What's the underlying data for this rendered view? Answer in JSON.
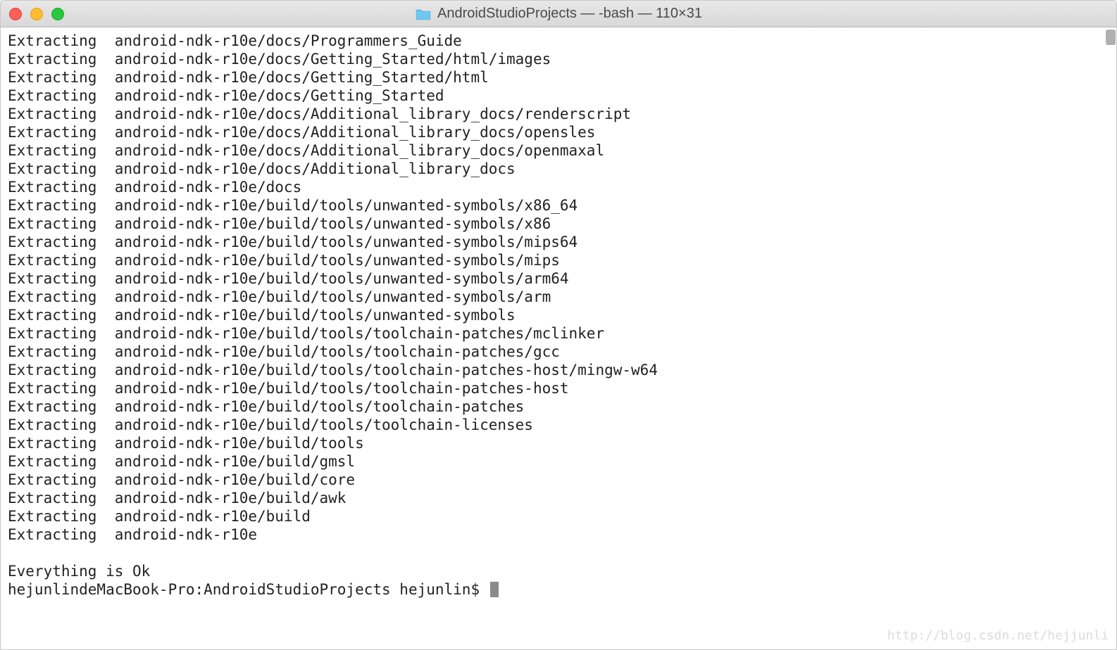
{
  "window": {
    "title": "AndroidStudioProjects — -bash — 110×31"
  },
  "terminal": {
    "lines": [
      {
        "prefix": "Extracting",
        "path": "android-ndk-r10e/docs/Programmers_Guide"
      },
      {
        "prefix": "Extracting",
        "path": "android-ndk-r10e/docs/Getting_Started/html/images"
      },
      {
        "prefix": "Extracting",
        "path": "android-ndk-r10e/docs/Getting_Started/html"
      },
      {
        "prefix": "Extracting",
        "path": "android-ndk-r10e/docs/Getting_Started"
      },
      {
        "prefix": "Extracting",
        "path": "android-ndk-r10e/docs/Additional_library_docs/renderscript"
      },
      {
        "prefix": "Extracting",
        "path": "android-ndk-r10e/docs/Additional_library_docs/opensles"
      },
      {
        "prefix": "Extracting",
        "path": "android-ndk-r10e/docs/Additional_library_docs/openmaxal"
      },
      {
        "prefix": "Extracting",
        "path": "android-ndk-r10e/docs/Additional_library_docs"
      },
      {
        "prefix": "Extracting",
        "path": "android-ndk-r10e/docs"
      },
      {
        "prefix": "Extracting",
        "path": "android-ndk-r10e/build/tools/unwanted-symbols/x86_64"
      },
      {
        "prefix": "Extracting",
        "path": "android-ndk-r10e/build/tools/unwanted-symbols/x86"
      },
      {
        "prefix": "Extracting",
        "path": "android-ndk-r10e/build/tools/unwanted-symbols/mips64"
      },
      {
        "prefix": "Extracting",
        "path": "android-ndk-r10e/build/tools/unwanted-symbols/mips"
      },
      {
        "prefix": "Extracting",
        "path": "android-ndk-r10e/build/tools/unwanted-symbols/arm64"
      },
      {
        "prefix": "Extracting",
        "path": "android-ndk-r10e/build/tools/unwanted-symbols/arm"
      },
      {
        "prefix": "Extracting",
        "path": "android-ndk-r10e/build/tools/unwanted-symbols"
      },
      {
        "prefix": "Extracting",
        "path": "android-ndk-r10e/build/tools/toolchain-patches/mclinker"
      },
      {
        "prefix": "Extracting",
        "path": "android-ndk-r10e/build/tools/toolchain-patches/gcc"
      },
      {
        "prefix": "Extracting",
        "path": "android-ndk-r10e/build/tools/toolchain-patches-host/mingw-w64"
      },
      {
        "prefix": "Extracting",
        "path": "android-ndk-r10e/build/tools/toolchain-patches-host"
      },
      {
        "prefix": "Extracting",
        "path": "android-ndk-r10e/build/tools/toolchain-patches"
      },
      {
        "prefix": "Extracting",
        "path": "android-ndk-r10e/build/tools/toolchain-licenses"
      },
      {
        "prefix": "Extracting",
        "path": "android-ndk-r10e/build/tools"
      },
      {
        "prefix": "Extracting",
        "path": "android-ndk-r10e/build/gmsl"
      },
      {
        "prefix": "Extracting",
        "path": "android-ndk-r10e/build/core"
      },
      {
        "prefix": "Extracting",
        "path": "android-ndk-r10e/build/awk"
      },
      {
        "prefix": "Extracting",
        "path": "android-ndk-r10e/build"
      },
      {
        "prefix": "Extracting",
        "path": "android-ndk-r10e"
      }
    ],
    "status": "Everything is Ok",
    "prompt": "hejunlindeMacBook-Pro:AndroidStudioProjects hejunlin$ "
  },
  "watermark": "http://blog.csdn.net/hejjunli"
}
